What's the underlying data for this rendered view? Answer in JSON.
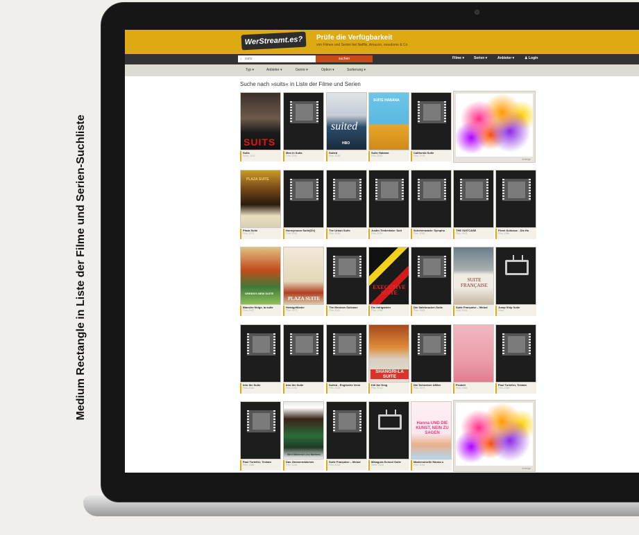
{
  "side_label": "Medium Rectangle in Liste der Filme und Serien-Suchliste",
  "site": {
    "logo": "WerStreamt.es?",
    "title": "Prüfe die Verfügbarkeit",
    "subtitle": "von Filmen und Serien bei Netflix, Amazon, maxdome & Co"
  },
  "search": {
    "value": "suits",
    "button": "suchen"
  },
  "nav": {
    "filme": "Filme ▾",
    "serien": "Serien ▾",
    "anbieter": "Anbieter ▾",
    "login": "♟ Login"
  },
  "filters": {
    "typ": "Typ ▾",
    "anbieter": "Anbieter ▾",
    "genre": "Genre ▾",
    "option": "Option ▾",
    "sortierung": "Sortierung ▾"
  },
  "results_title": "Suche nach »suits« in Liste der Filme und Serien",
  "ad_label": "Anzeige",
  "tiles": [
    {
      "title": "Suits",
      "meta": "Serie, 2011",
      "poster": "suits"
    },
    {
      "title": "Men in Suits",
      "meta": "Film, 2012",
      "poster": "film"
    },
    {
      "title": "Suited",
      "meta": "Film, 2016",
      "poster": "suited"
    },
    {
      "title": "Suite Habana",
      "meta": "Film, 2003",
      "poster": "havana"
    },
    {
      "title": "California Suite",
      "meta": "Film, 1978",
      "poster": "film"
    },
    {
      "title": "Plaza Suite",
      "meta": "Film, 1971",
      "poster": "plaza"
    },
    {
      "title": "Honeymoon Suite(DV)",
      "meta": "Film, 2013",
      "poster": "film"
    },
    {
      "title": "The Urban Suite",
      "meta": "Film, 2016",
      "poster": "film"
    },
    {
      "title": "Justin Timberlake: Suit",
      "meta": "Film, 2014",
      "poster": "film"
    },
    {
      "title": "Scheherazade: Sympho",
      "meta": "Film, 2006",
      "poster": "film"
    },
    {
      "title": "THE SUITCASE",
      "meta": "Film, 2013",
      "poster": "film"
    },
    {
      "title": "Flesh Suitcase - Die Ho",
      "meta": "Film, 1984",
      "poster": "film"
    },
    {
      "title": "Blanche Neige, la suite",
      "meta": "Film, 2007",
      "poster": "blanche"
    },
    {
      "title": "Hotelgeflüster",
      "meta": "Film, 1971",
      "poster": "hotel"
    },
    {
      "title": "The Mexican Suitcase",
      "meta": "Film, 2011",
      "poster": "film"
    },
    {
      "title": "Die Intriganten",
      "meta": "Film, 1954",
      "poster": "exec"
    },
    {
      "title": "Die Safeknacker-Suite",
      "meta": "Film, 1963",
      "poster": "film"
    },
    {
      "title": "Suite Française – Melod",
      "meta": "Film, 2014",
      "poster": "francaise"
    },
    {
      "title": "Jump Ship Suite",
      "meta": "Serie",
      "poster": "tv"
    },
    {
      "title": "Into the Suite",
      "meta": "Film, 2016",
      "poster": "film"
    },
    {
      "title": "Into the Suite",
      "meta": "Film, 2016",
      "poster": "film"
    },
    {
      "title": "Suited - Englische Versi",
      "meta": "Film, 2016",
      "poster": "film"
    },
    {
      "title": "Kill the King",
      "meta": "Film, 2013",
      "poster": "shangri"
    },
    {
      "title": "Die Schweizer Affäre",
      "meta": "Film, 1979",
      "poster": "film"
    },
    {
      "title": "Probeit",
      "meta": "Film, 1969",
      "poster": "probe"
    },
    {
      "title": "Paul Tortelier, Textam",
      "meta": "Film, 1968",
      "poster": "film"
    },
    {
      "title": "Paul Tortelier, Textam",
      "meta": "Film, 1968",
      "poster": "film"
    },
    {
      "title": "Das Zimmermädchen",
      "meta": "Film, 2018",
      "poster": "zimmer"
    },
    {
      "title": "Suite Française – Melod",
      "meta": "Film, 2014",
      "poster": "film"
    },
    {
      "title": "Mikagura School Suite",
      "meta": "Serie, 2015",
      "poster": "tv"
    },
    {
      "title": "Mademoiselle Hanna u",
      "meta": "Film, 2016",
      "poster": "nein"
    }
  ],
  "poster_texts": {
    "suits": "SUITS",
    "suited": "suited",
    "suited_brand": "HBO",
    "havana": "SUITE HABANA",
    "plaza": "PLAZA SUITE",
    "blanche": "GREEN'S NEW SUITE",
    "hotel": "PLAZA SUITE",
    "exec": "EXECUTIVE SUITE",
    "francaise": "SUITE FRANÇAISE",
    "shangri": "SHANGRI-LA SUITE",
    "zimmer": "Wied Mainenia   Lino Martinez",
    "nein": "Hanna UND DIE KUNST, NEIN ZU SAGEN"
  }
}
